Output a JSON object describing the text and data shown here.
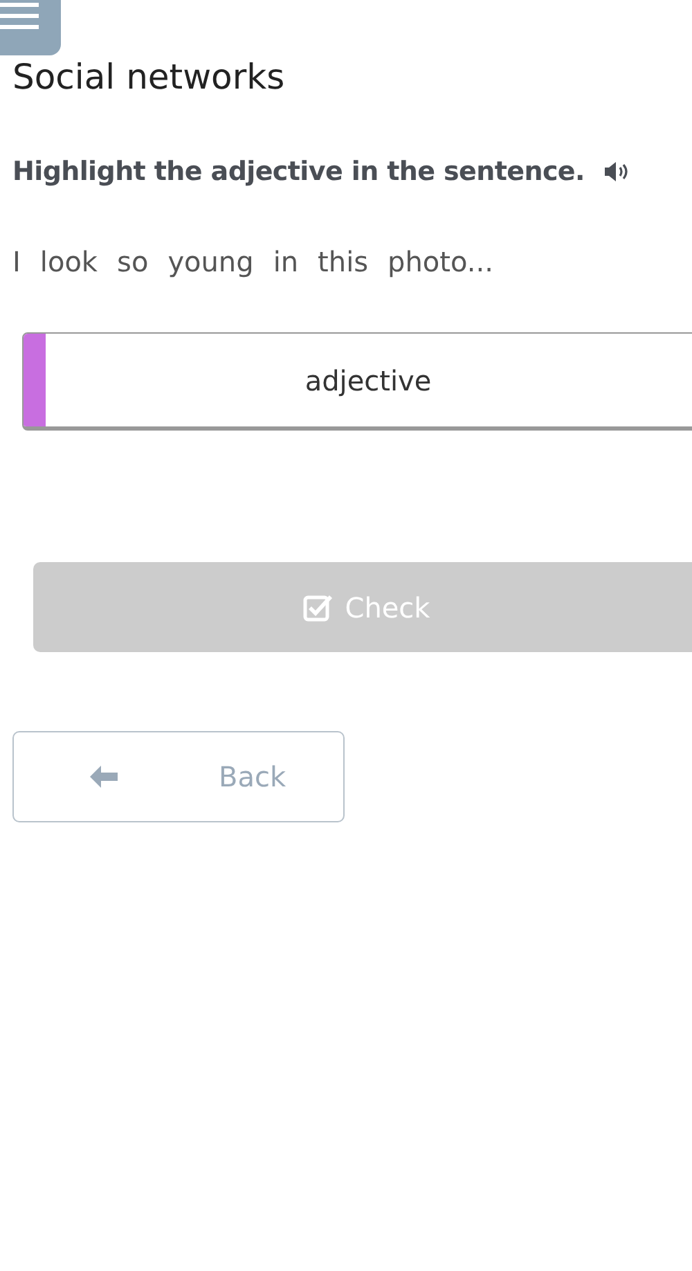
{
  "title": "Social networks",
  "instruction": "Highlight the adjective in the sentence.",
  "sentence_words": [
    {
      "text": "I",
      "selected": false
    },
    {
      "text": "look",
      "selected": false
    },
    {
      "text": "so",
      "selected": false
    },
    {
      "text": "young",
      "selected": false
    },
    {
      "text": "in",
      "selected": false
    },
    {
      "text": "this",
      "selected": false
    },
    {
      "text": "photo...",
      "selected": false
    }
  ],
  "answer_box": {
    "label": "adjective",
    "color": "#c86ee0"
  },
  "check_button": {
    "label": "Check",
    "disabled": true
  },
  "back_button": {
    "label": "Back"
  }
}
